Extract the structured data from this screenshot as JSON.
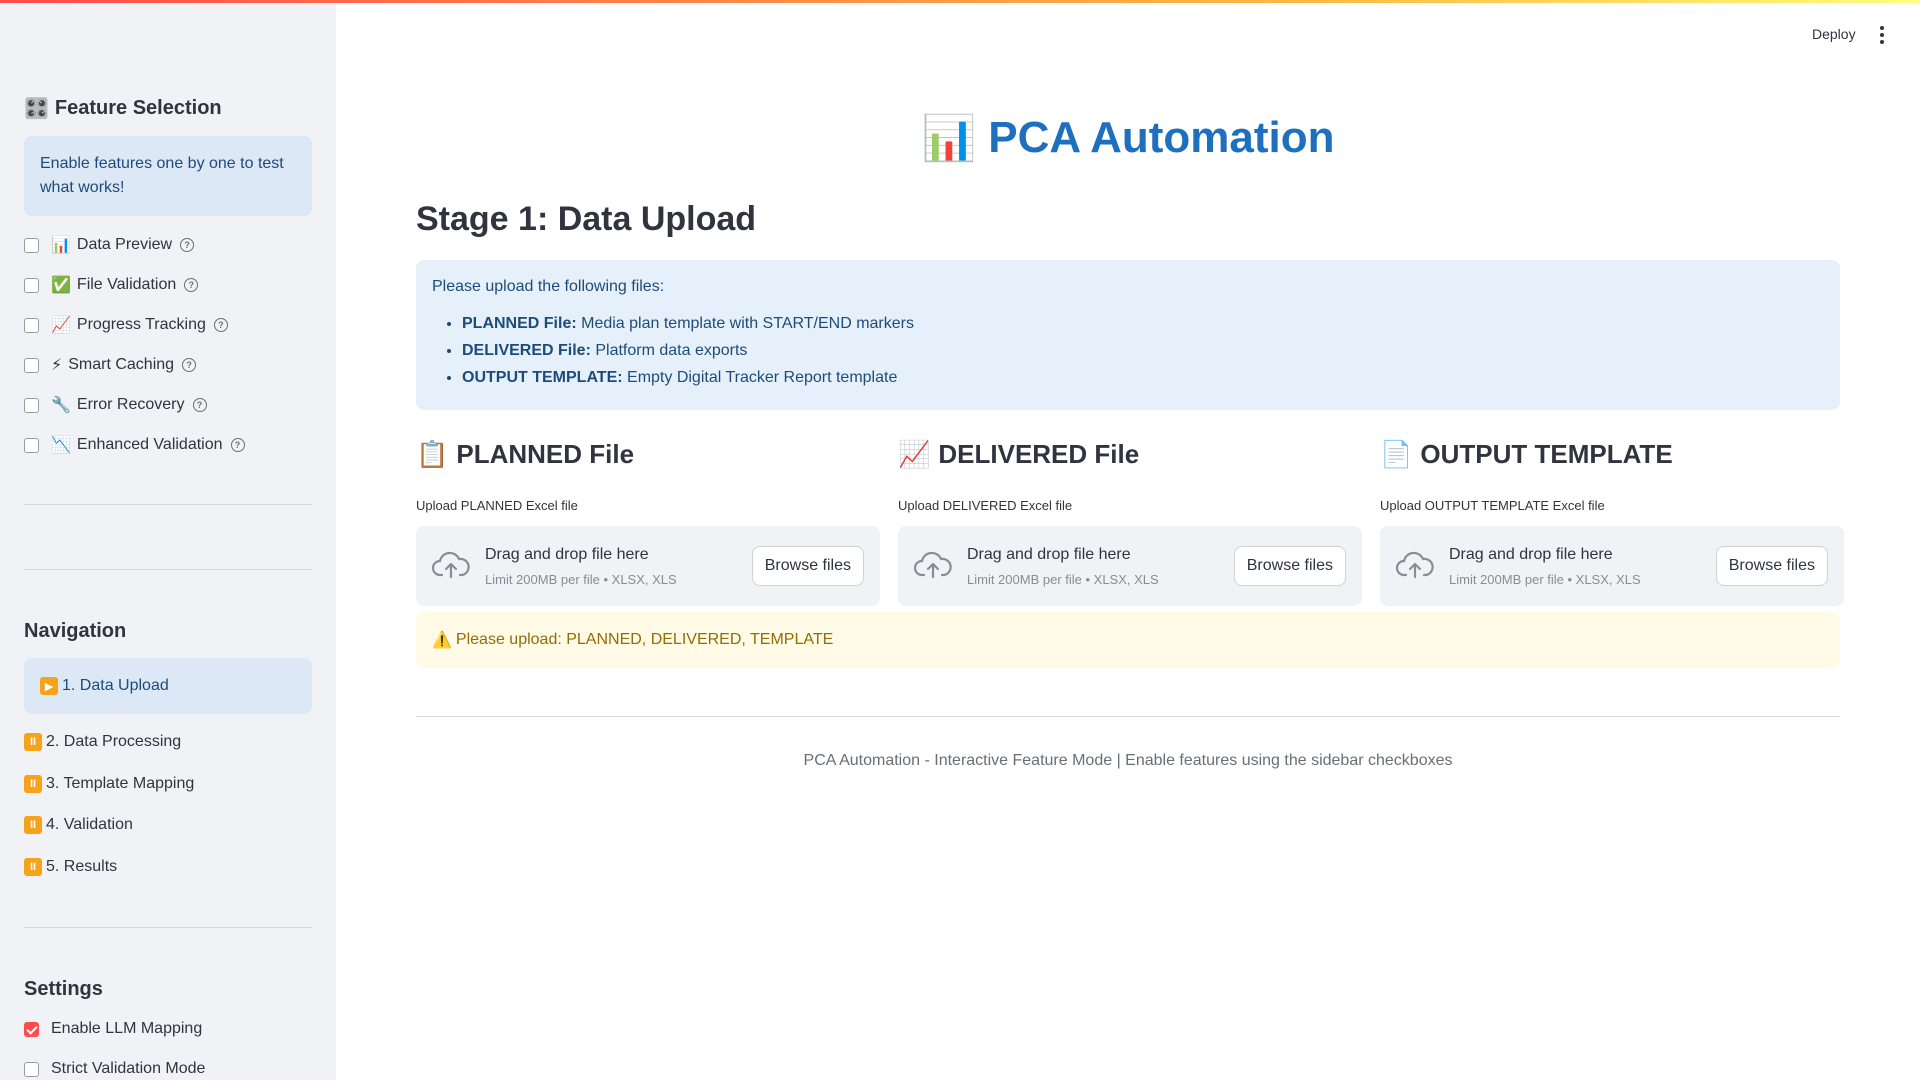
{
  "sidebar": {
    "feature_title": "Feature Selection",
    "feature_icon": "🎛️",
    "info": "Enable features one by one to test what works!",
    "features": [
      {
        "emoji": "📊",
        "label": "Data Preview"
      },
      {
        "emoji": "✅",
        "label": "File Validation"
      },
      {
        "emoji": "📈",
        "label": "Progress Tracking"
      },
      {
        "emoji": "⚡",
        "label": "Smart Caching"
      },
      {
        "emoji": "🔧",
        "label": "Error Recovery"
      },
      {
        "emoji": "📉",
        "label": "Enhanced Validation"
      }
    ],
    "nav_title": "Navigation",
    "nav": [
      {
        "icon": "▶️",
        "label": "1. Data Upload"
      },
      {
        "icon": "⏸",
        "label": "2. Data Processing"
      },
      {
        "icon": "⏸",
        "label": "3. Template Mapping"
      },
      {
        "icon": "⏸",
        "label": "4. Validation"
      },
      {
        "icon": "⏸",
        "label": "5. Results"
      }
    ],
    "settings_title": "Settings",
    "settings": [
      {
        "label": "Enable LLM Mapping",
        "checked": true
      },
      {
        "label": "Strict Validation Mode",
        "checked": false
      }
    ]
  },
  "header": {
    "deploy_label": "Deploy"
  },
  "main": {
    "app_icon": "📊",
    "app_title": "PCA Automation",
    "stage_title": "Stage 1: Data Upload",
    "upload_intro": "Please upload the following files:",
    "upload_items": [
      {
        "name": "PLANNED File:",
        "desc": "Media plan template with START/END markers"
      },
      {
        "name": "DELIVERED File:",
        "desc": "Platform data exports"
      },
      {
        "name": "OUTPUT TEMPLATE:",
        "desc": "Empty Digital Tracker Report template"
      }
    ],
    "uploaders": [
      {
        "icon": "📋",
        "title": "PLANNED File",
        "label": "Upload PLANNED Excel file"
      },
      {
        "icon": "📈",
        "title": "DELIVERED File",
        "label": "Upload DELIVERED Excel file"
      },
      {
        "icon": "📄",
        "title": "OUTPUT TEMPLATE",
        "label": "Upload OUTPUT TEMPLATE Excel file"
      }
    ],
    "dropzone_text": "Drag and drop file here",
    "dropzone_limit": "Limit 200MB per file • XLSX, XLS",
    "browse_label": "Browse files",
    "warning_icon": "⚠️",
    "warning_text": "Please upload: PLANNED, DELIVERED, TEMPLATE",
    "footer": "PCA Automation - Interactive Feature Mode | Enable features using the sidebar checkboxes"
  }
}
